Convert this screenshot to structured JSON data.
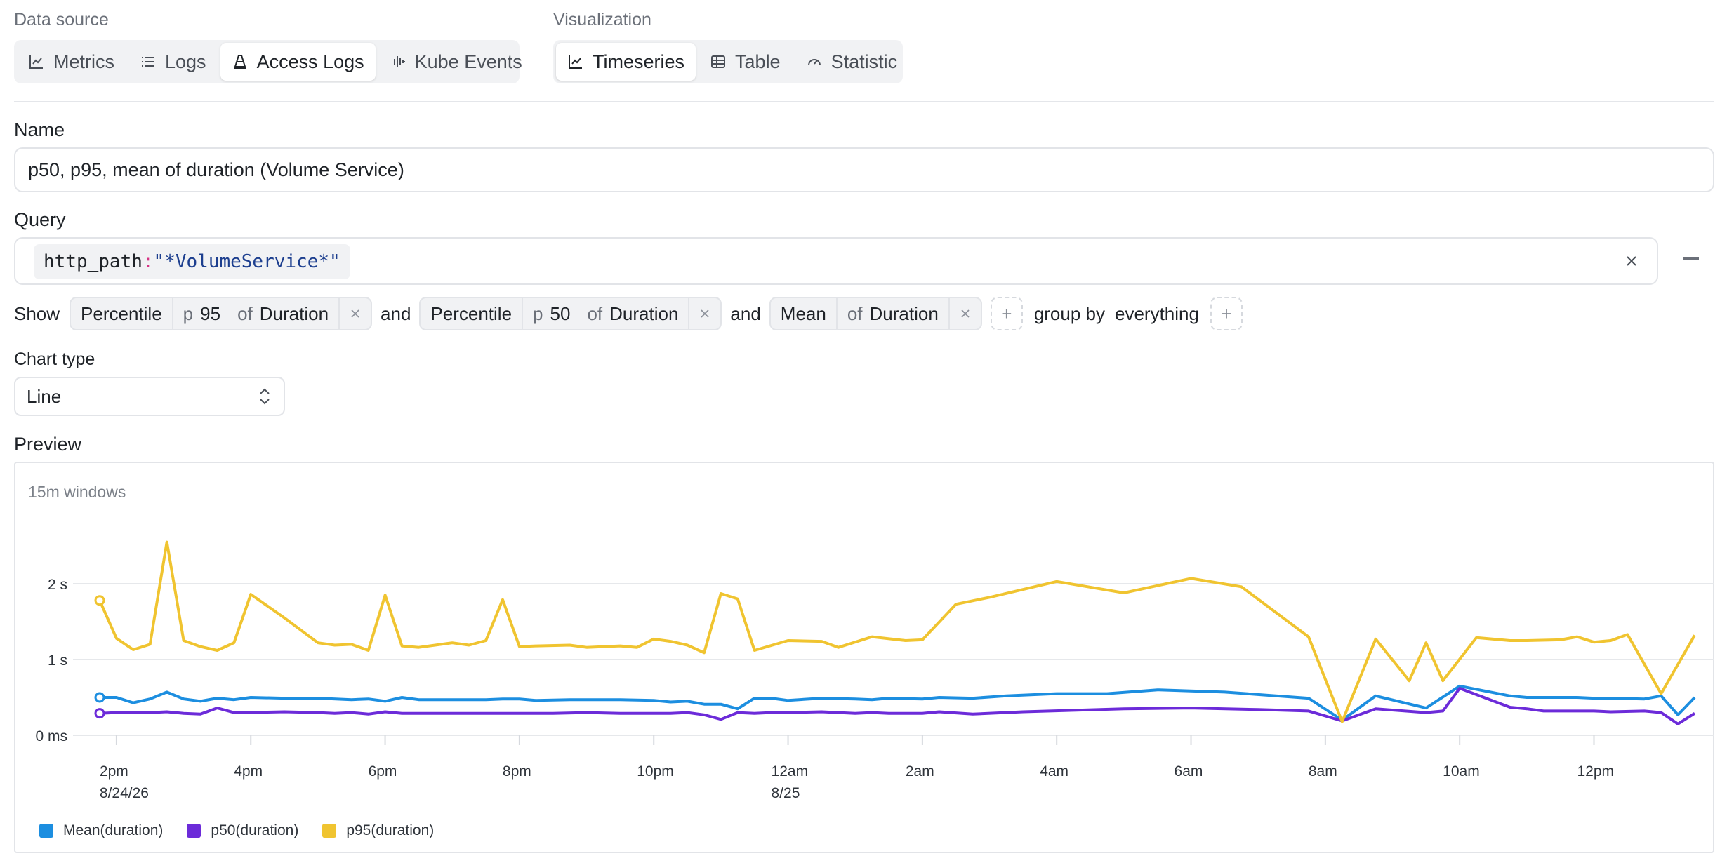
{
  "data_source": {
    "label": "Data source",
    "options": [
      {
        "label": "Metrics",
        "icon": "line-chart-icon",
        "active": false
      },
      {
        "label": "Logs",
        "icon": "list-icon",
        "active": false
      },
      {
        "label": "Access Logs",
        "icon": "traffic-cone-icon",
        "active": true
      },
      {
        "label": "Kube Events",
        "icon": "audio-waveform-icon",
        "active": false
      }
    ]
  },
  "visualization": {
    "label": "Visualization",
    "options": [
      {
        "label": "Timeseries",
        "icon": "line-chart-icon",
        "active": true
      },
      {
        "label": "Table",
        "icon": "table-icon",
        "active": false
      },
      {
        "label": "Statistic",
        "icon": "gauge-icon",
        "active": false
      }
    ]
  },
  "name_field": {
    "label": "Name",
    "value": "p50, p95, mean of duration (Volume Service)"
  },
  "query": {
    "label": "Query",
    "key": "http_path",
    "colon": ":",
    "value": "\"*VolumeService*\""
  },
  "show": {
    "label": "Show",
    "connector": "and",
    "aggregations": [
      {
        "fn": "Percentile",
        "p_prefix": "p",
        "p_value": "95",
        "of": "of",
        "field": "Duration"
      },
      {
        "fn": "Percentile",
        "p_prefix": "p",
        "p_value": "50",
        "of": "of",
        "field": "Duration"
      },
      {
        "fn": "Mean",
        "of": "of",
        "field": "Duration"
      }
    ],
    "add_symbol": "+",
    "group_by_label": "group by",
    "group_by_value": "everything"
  },
  "chart_type": {
    "label": "Chart type",
    "value": "Line"
  },
  "preview": {
    "label": "Preview",
    "windows_label": "15m windows"
  },
  "chart_data": {
    "type": "line",
    "y_unit": "s",
    "ylim": [
      0,
      2.6
    ],
    "y_ticks": [
      {
        "value": 0,
        "label": "0 ms"
      },
      {
        "value": 1,
        "label": "1 s"
      },
      {
        "value": 2,
        "label": "2 s"
      }
    ],
    "x_range_hours": [
      13.5,
      37.5
    ],
    "x_ticks": [
      {
        "hour": 14,
        "label": "2pm",
        "sub": "8/24/26"
      },
      {
        "hour": 16,
        "label": "4pm",
        "sub": ""
      },
      {
        "hour": 18,
        "label": "6pm",
        "sub": ""
      },
      {
        "hour": 20,
        "label": "8pm",
        "sub": ""
      },
      {
        "hour": 22,
        "label": "10pm",
        "sub": ""
      },
      {
        "hour": 24,
        "label": "12am",
        "sub": "8/25"
      },
      {
        "hour": 26,
        "label": "2am",
        "sub": ""
      },
      {
        "hour": 28,
        "label": "4am",
        "sub": ""
      },
      {
        "hour": 30,
        "label": "6am",
        "sub": ""
      },
      {
        "hour": 32,
        "label": "8am",
        "sub": ""
      },
      {
        "hour": 34,
        "label": "10am",
        "sub": ""
      },
      {
        "hour": 36,
        "label": "12pm",
        "sub": ""
      }
    ],
    "grid": true,
    "legend_position": "bottom-left",
    "series": [
      {
        "name": "Mean(duration)",
        "color": "#1c8ee0",
        "points": [
          [
            13.75,
            0.5
          ],
          [
            14,
            0.5
          ],
          [
            14.25,
            0.43
          ],
          [
            14.5,
            0.48
          ],
          [
            14.75,
            0.57
          ],
          [
            15,
            0.48
          ],
          [
            15.25,
            0.45
          ],
          [
            15.5,
            0.49
          ],
          [
            15.75,
            0.47
          ],
          [
            16,
            0.5
          ],
          [
            16.5,
            0.49
          ],
          [
            17,
            0.49
          ],
          [
            17.5,
            0.47
          ],
          [
            17.75,
            0.48
          ],
          [
            18,
            0.45
          ],
          [
            18.25,
            0.5
          ],
          [
            18.5,
            0.47
          ],
          [
            19,
            0.47
          ],
          [
            19.5,
            0.47
          ],
          [
            19.75,
            0.48
          ],
          [
            20,
            0.48
          ],
          [
            20.25,
            0.46
          ],
          [
            20.75,
            0.47
          ],
          [
            21,
            0.47
          ],
          [
            21.5,
            0.47
          ],
          [
            22,
            0.46
          ],
          [
            22.25,
            0.44
          ],
          [
            22.5,
            0.45
          ],
          [
            22.75,
            0.41
          ],
          [
            23,
            0.41
          ],
          [
            23.25,
            0.35
          ],
          [
            23.5,
            0.49
          ],
          [
            23.75,
            0.49
          ],
          [
            24,
            0.46
          ],
          [
            24.5,
            0.49
          ],
          [
            25,
            0.48
          ],
          [
            25.25,
            0.47
          ],
          [
            25.5,
            0.49
          ],
          [
            26,
            0.48
          ],
          [
            26.25,
            0.5
          ],
          [
            26.75,
            0.49
          ],
          [
            27.25,
            0.52
          ],
          [
            28,
            0.55
          ],
          [
            28.75,
            0.55
          ],
          [
            29.5,
            0.6
          ],
          [
            30.5,
            0.57
          ],
          [
            31.75,
            0.49
          ],
          [
            32.25,
            0.2
          ],
          [
            32.75,
            0.52
          ],
          [
            33.5,
            0.36
          ],
          [
            34,
            0.65
          ],
          [
            34.75,
            0.52
          ],
          [
            35,
            0.5
          ],
          [
            35.25,
            0.5
          ],
          [
            35.75,
            0.5
          ],
          [
            36,
            0.49
          ],
          [
            36.25,
            0.49
          ],
          [
            36.75,
            0.48
          ],
          [
            37,
            0.52
          ],
          [
            37.25,
            0.27
          ],
          [
            37.5,
            0.5
          ]
        ]
      },
      {
        "name": "p50(duration)",
        "color": "#6c2bd9",
        "points": [
          [
            13.75,
            0.29
          ],
          [
            14,
            0.3
          ],
          [
            14.5,
            0.3
          ],
          [
            14.75,
            0.31
          ],
          [
            15,
            0.29
          ],
          [
            15.25,
            0.28
          ],
          [
            15.5,
            0.36
          ],
          [
            15.75,
            0.3
          ],
          [
            16,
            0.3
          ],
          [
            16.5,
            0.31
          ],
          [
            17,
            0.3
          ],
          [
            17.25,
            0.29
          ],
          [
            17.5,
            0.3
          ],
          [
            17.75,
            0.28
          ],
          [
            18,
            0.31
          ],
          [
            18.25,
            0.29
          ],
          [
            19,
            0.29
          ],
          [
            19.5,
            0.29
          ],
          [
            19.75,
            0.29
          ],
          [
            20,
            0.29
          ],
          [
            20.5,
            0.29
          ],
          [
            21,
            0.3
          ],
          [
            21.5,
            0.29
          ],
          [
            22,
            0.29
          ],
          [
            22.25,
            0.29
          ],
          [
            22.5,
            0.3
          ],
          [
            22.75,
            0.27
          ],
          [
            23,
            0.21
          ],
          [
            23.25,
            0.3
          ],
          [
            23.5,
            0.29
          ],
          [
            23.75,
            0.3
          ],
          [
            24,
            0.3
          ],
          [
            24.5,
            0.31
          ],
          [
            25,
            0.29
          ],
          [
            25.25,
            0.3
          ],
          [
            25.5,
            0.29
          ],
          [
            26,
            0.29
          ],
          [
            26.25,
            0.31
          ],
          [
            26.75,
            0.28
          ],
          [
            27.5,
            0.31
          ],
          [
            28.25,
            0.33
          ],
          [
            29,
            0.35
          ],
          [
            30,
            0.36
          ],
          [
            31,
            0.34
          ],
          [
            31.75,
            0.32
          ],
          [
            32.25,
            0.19
          ],
          [
            32.75,
            0.35
          ],
          [
            33.5,
            0.3
          ],
          [
            33.75,
            0.32
          ],
          [
            34,
            0.62
          ],
          [
            34.75,
            0.37
          ],
          [
            35,
            0.35
          ],
          [
            35.25,
            0.32
          ],
          [
            36,
            0.32
          ],
          [
            36.25,
            0.31
          ],
          [
            36.75,
            0.32
          ],
          [
            37,
            0.3
          ],
          [
            37.25,
            0.15
          ],
          [
            37.5,
            0.29
          ]
        ]
      },
      {
        "name": "p95(duration)",
        "color": "#f0c430",
        "points": [
          [
            13.75,
            1.78
          ],
          [
            14,
            1.28
          ],
          [
            14.25,
            1.13
          ],
          [
            14.5,
            1.2
          ],
          [
            14.75,
            2.55
          ],
          [
            15,
            1.25
          ],
          [
            15.25,
            1.17
          ],
          [
            15.5,
            1.12
          ],
          [
            15.75,
            1.22
          ],
          [
            16,
            1.86
          ],
          [
            16.5,
            1.55
          ],
          [
            17,
            1.22
          ],
          [
            17.25,
            1.19
          ],
          [
            17.5,
            1.2
          ],
          [
            17.75,
            1.12
          ],
          [
            18,
            1.85
          ],
          [
            18.25,
            1.18
          ],
          [
            18.5,
            1.16
          ],
          [
            19,
            1.22
          ],
          [
            19.25,
            1.19
          ],
          [
            19.5,
            1.25
          ],
          [
            19.75,
            1.79
          ],
          [
            20,
            1.17
          ],
          [
            20.25,
            1.18
          ],
          [
            20.75,
            1.19
          ],
          [
            21,
            1.16
          ],
          [
            21.5,
            1.18
          ],
          [
            21.75,
            1.16
          ],
          [
            22,
            1.27
          ],
          [
            22.25,
            1.24
          ],
          [
            22.5,
            1.19
          ],
          [
            22.75,
            1.09
          ],
          [
            23,
            1.87
          ],
          [
            23.25,
            1.8
          ],
          [
            23.5,
            1.12
          ],
          [
            24,
            1.25
          ],
          [
            24.5,
            1.24
          ],
          [
            24.75,
            1.16
          ],
          [
            25.25,
            1.3
          ],
          [
            25.75,
            1.25
          ],
          [
            26,
            1.26
          ],
          [
            26.5,
            1.73
          ],
          [
            27,
            1.82
          ],
          [
            28,
            2.03
          ],
          [
            29,
            1.88
          ],
          [
            30,
            2.07
          ],
          [
            30.75,
            1.96
          ],
          [
            31.75,
            1.3
          ],
          [
            32.25,
            0.18
          ],
          [
            32.75,
            1.27
          ],
          [
            33.25,
            0.72
          ],
          [
            33.5,
            1.22
          ],
          [
            33.75,
            0.72
          ],
          [
            34.25,
            1.29
          ],
          [
            34.75,
            1.25
          ],
          [
            35,
            1.25
          ],
          [
            35.5,
            1.26
          ],
          [
            35.75,
            1.3
          ],
          [
            36,
            1.23
          ],
          [
            36.25,
            1.25
          ],
          [
            36.5,
            1.33
          ],
          [
            37,
            0.55
          ],
          [
            37.5,
            1.32
          ]
        ]
      }
    ]
  }
}
